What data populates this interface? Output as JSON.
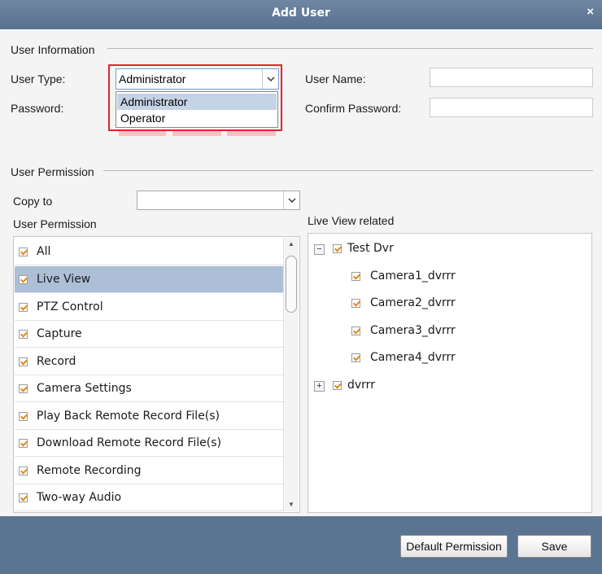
{
  "dialog": {
    "title": "Add User",
    "close_glyph": "×"
  },
  "user_info": {
    "group_label": "User Information",
    "user_type_label": "User Type:",
    "user_type_value": "Administrator",
    "user_type_options": [
      "Administrator",
      "Operator"
    ],
    "user_name_label": "User Name:",
    "user_name_value": "",
    "password_label": "Password:",
    "confirm_password_label": "Confirm Password:"
  },
  "user_permission": {
    "group_label": "User Permission",
    "copy_to_label": "Copy to",
    "copy_to_value": "",
    "list_label": "User Permission",
    "items": [
      {
        "label": "All",
        "checked": true
      },
      {
        "label": "Live View",
        "checked": true,
        "selected": true
      },
      {
        "label": "PTZ Control",
        "checked": true
      },
      {
        "label": "Capture",
        "checked": true
      },
      {
        "label": "Record",
        "checked": true
      },
      {
        "label": "Camera Settings",
        "checked": true
      },
      {
        "label": "Play Back Remote Record File(s)",
        "checked": true
      },
      {
        "label": "Download Remote Record File(s)",
        "checked": true
      },
      {
        "label": "Remote Recording",
        "checked": true
      },
      {
        "label": "Two-way Audio",
        "checked": true
      }
    ]
  },
  "live_view_related": {
    "label": "Live View related",
    "tree": [
      {
        "label": "Test Dvr",
        "expanded": true,
        "checked": true,
        "children": [
          {
            "label": "Camera1_dvrrr",
            "checked": true
          },
          {
            "label": "Camera2_dvrrr",
            "checked": true
          },
          {
            "label": "Camera3_dvrrr",
            "checked": true
          },
          {
            "label": "Camera4_dvrrr",
            "checked": true
          }
        ]
      },
      {
        "label": "dvrrr",
        "expanded": false,
        "checked": true
      }
    ]
  },
  "buttons": {
    "default_permission": "Default Permission",
    "save": "Save"
  },
  "colors": {
    "frame": "#5b7491",
    "selection": "#adbfd7",
    "highlight_border": "#e0262d",
    "check": "#e08a1f"
  }
}
